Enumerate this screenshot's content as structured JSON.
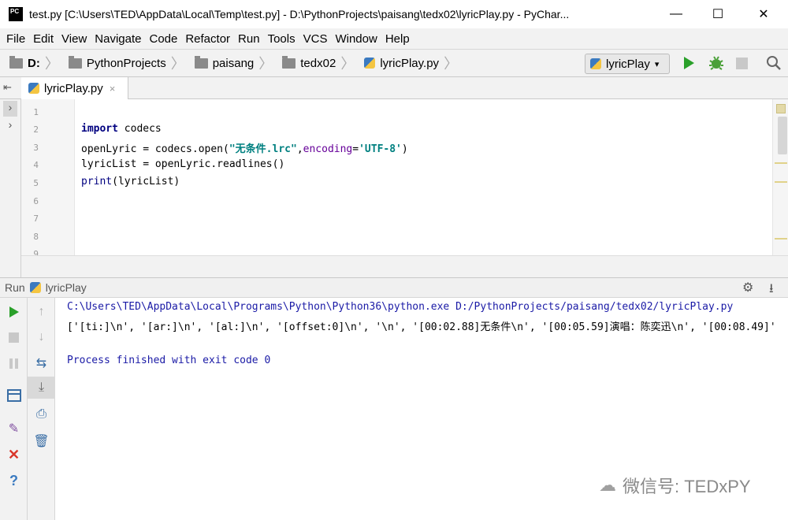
{
  "window": {
    "app_logo": "PC",
    "title": "test.py [C:\\Users\\TED\\AppData\\Local\\Temp\\test.py] - D:\\PythonProjects\\paisang\\tedx02\\lyricPlay.py - PyChar...",
    "minimize": "—",
    "maximize": "☐",
    "close": "✕"
  },
  "menu": [
    "File",
    "Edit",
    "View",
    "Navigate",
    "Code",
    "Refactor",
    "Run",
    "Tools",
    "VCS",
    "Window",
    "Help"
  ],
  "breadcrumb": [
    "D:",
    "PythonProjects",
    "paisang",
    "tedx02",
    "lyricPlay.py"
  ],
  "run_config": "lyricPlay",
  "tab": {
    "label": "lyricPlay.py",
    "close": "×"
  },
  "gutter_lines": [
    "1",
    "2",
    "3",
    "4",
    "5",
    "6",
    "7",
    "8",
    "9"
  ],
  "code": {
    "l2_kw": "import",
    "l2_rest": " codecs",
    "l3_a": "openLyric = codecs.open(",
    "l3_str1": "\"无条件.lrc\"",
    "l3_comma": ",",
    "l3_param": "encoding",
    "l3_eq": "=",
    "l3_str2": "'UTF-8'",
    "l3_close": ")",
    "l4": "lyricList = openLyric.readlines()",
    "l5_fn": "print",
    "l5_rest": "(lyricList)"
  },
  "run_panel": {
    "label": "Run",
    "config": "lyricPlay",
    "gear": "⚙",
    "pin": "⭳"
  },
  "console": {
    "cmd": "C:\\Users\\TED\\AppData\\Local\\Programs\\Python\\Python36\\python.exe D:/PythonProjects/paisang/tedx02/lyricPlay.py",
    "output": "['[ti:]\\n', '[ar:]\\n', '[al:]\\n', '[offset:0]\\n', '\\n', '[00:02.88]无条件\\n', '[00:05.59]演唱：陈奕迅\\n', '[00:08.49]'",
    "finished": "Process finished with exit code 0"
  },
  "watermark": "微信号: TEDxPY",
  "colors": {
    "console_blue": "#1a1aa6",
    "run_green": "#2aa02a",
    "close_red": "#d9362a",
    "console_output": "#000000"
  }
}
